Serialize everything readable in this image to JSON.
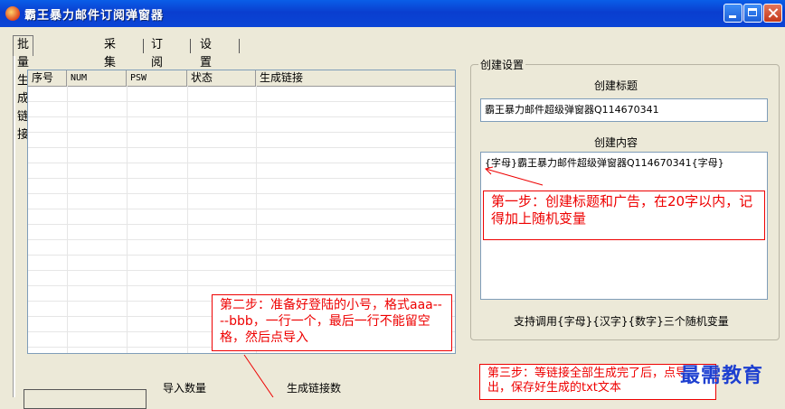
{
  "window": {
    "title": "霸王暴力邮件订阅弹窗器"
  },
  "tabs": [
    {
      "label": "批量生成链接"
    },
    {
      "label": "采集"
    },
    {
      "label": "订阅"
    },
    {
      "label": "设置"
    }
  ],
  "table": {
    "columns": [
      "序号",
      "NUM",
      "PSW",
      "状态",
      "生成链接"
    ]
  },
  "create_settings": {
    "legend": "创建设置",
    "title_label": "创建标题",
    "title_value": "霸王暴力邮件超级弹窗器Q114670341",
    "content_label": "创建内容",
    "content_value": "{字母}霸王暴力邮件超级弹窗器Q114670341{字母}",
    "variables_hint": "支持调用{字母}{汉字}{数字}三个随机变量"
  },
  "bottom": {
    "import_count_label": "导入数量",
    "generated_count_label": "生成链接数"
  },
  "annotations": {
    "step1": "第一步：创建标题和广告，在20字以内，记得加上随机变量",
    "step2": "第二步：准备好登陆的小号，格式aaa----bbb，一行一个，最后一行不能留空格，然后点导入",
    "step3": "第三步：等链接全部生成完了后，点导出，保存好生成的txt文本"
  },
  "watermark": "最需教育",
  "colors": {
    "annotation": "#ee0000",
    "titlebar": "#0a4fd8",
    "watermark": "#1d3fd0"
  }
}
